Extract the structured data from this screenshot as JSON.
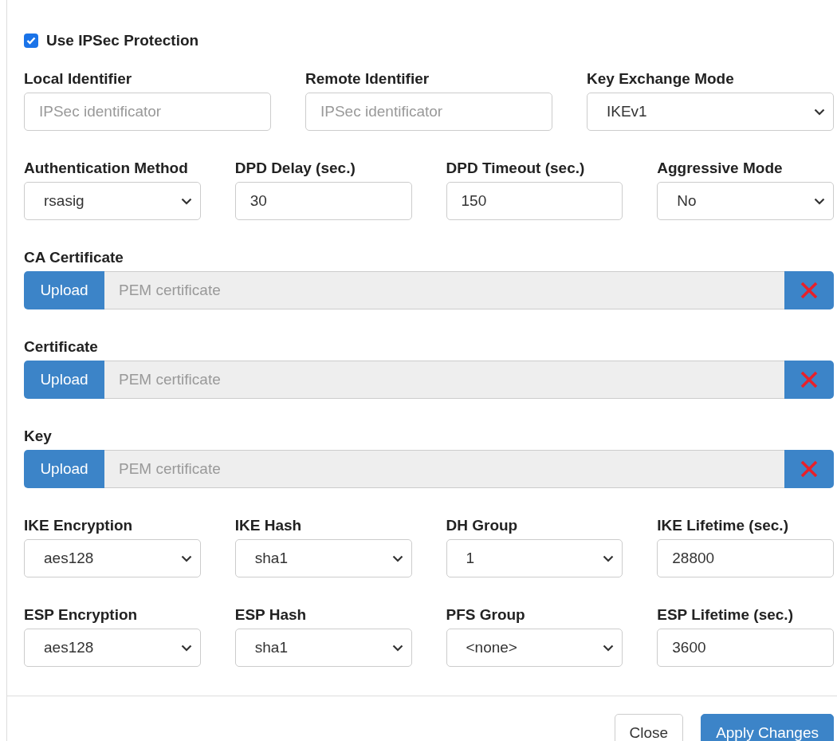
{
  "ipsec": {
    "label": "Use IPSec Protection",
    "checked": true
  },
  "rows_top": [
    [
      {
        "label": "Local Identifier",
        "kind": "text",
        "placeholder": "IPSec identificator"
      },
      {
        "label": "Remote Identifier",
        "kind": "text",
        "placeholder": "IPSec identificator"
      },
      {
        "label": "Key Exchange Mode",
        "kind": "select",
        "value": "IKEv1"
      }
    ],
    [
      {
        "label": "Authentication Method",
        "kind": "select",
        "value": "rsasig"
      },
      {
        "label": "DPD Delay (sec.)",
        "kind": "text",
        "value": "30"
      },
      {
        "label": "DPD Timeout (sec.)",
        "kind": "text",
        "value": "150"
      },
      {
        "label": "Aggressive Mode",
        "kind": "select",
        "value": "No"
      }
    ]
  ],
  "uploads": [
    {
      "label": "CA Certificate",
      "button": "Upload",
      "placeholder": "PEM certificate"
    },
    {
      "label": "Certificate",
      "button": "Upload",
      "placeholder": "PEM certificate"
    },
    {
      "label": "Key",
      "button": "Upload",
      "placeholder": "PEM certificate"
    }
  ],
  "rows_bottom": [
    [
      {
        "label": "IKE Encryption",
        "kind": "select",
        "value": "aes128"
      },
      {
        "label": "IKE Hash",
        "kind": "select",
        "value": "sha1"
      },
      {
        "label": "DH Group",
        "kind": "select",
        "value": "1"
      },
      {
        "label": "IKE Lifetime (sec.)",
        "kind": "text",
        "value": "28800"
      }
    ],
    [
      {
        "label": "ESP Encryption",
        "kind": "select",
        "value": "aes128"
      },
      {
        "label": "ESP Hash",
        "kind": "select",
        "value": "sha1"
      },
      {
        "label": "PFS Group",
        "kind": "select",
        "value": "<none>"
      },
      {
        "label": "ESP Lifetime (sec.)",
        "kind": "text",
        "value": "3600"
      }
    ]
  ],
  "footer": {
    "buttons": [
      {
        "label": "Close",
        "kind": "secondary"
      },
      {
        "label": "Apply Changes",
        "kind": "primary"
      }
    ]
  }
}
